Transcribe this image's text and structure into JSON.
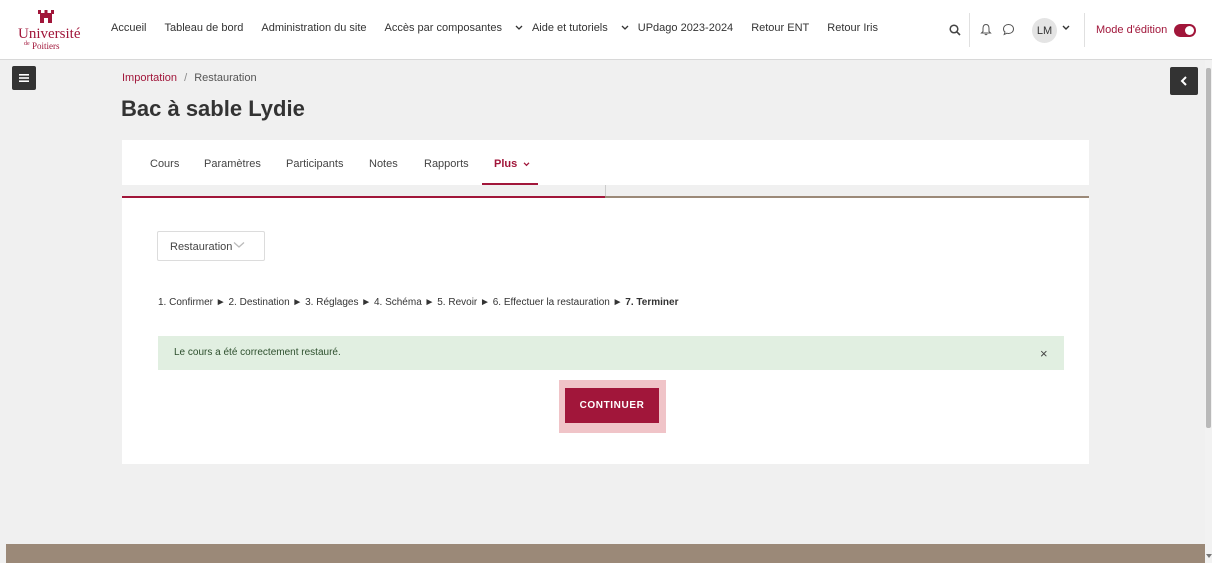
{
  "brand": {
    "univ": "Université",
    "de": "de",
    "poitiers": "Poitiers"
  },
  "nav": {
    "items": [
      {
        "label": "Accueil",
        "dropdown": false
      },
      {
        "label": "Tableau de bord",
        "dropdown": false
      },
      {
        "label": "Administration du site",
        "dropdown": false
      },
      {
        "label": "Accès par composantes",
        "dropdown": true
      },
      {
        "label": "Aide et tutoriels",
        "dropdown": true
      },
      {
        "label": "UPdago 2023-2024",
        "dropdown": false
      },
      {
        "label": "Retour ENT",
        "dropdown": false
      },
      {
        "label": "Retour Iris",
        "dropdown": false
      }
    ]
  },
  "user": {
    "initials": "LM",
    "edit_mode_label": "Mode d'édition",
    "edit_mode_on": true
  },
  "breadcrumb": {
    "link": "Importation",
    "separator": "/",
    "current": "Restauration"
  },
  "course": {
    "title": "Bac à sable Lydie"
  },
  "tabs": [
    {
      "label": "Cours",
      "active": false
    },
    {
      "label": "Paramètres",
      "active": false
    },
    {
      "label": "Participants",
      "active": false
    },
    {
      "label": "Notes",
      "active": false
    },
    {
      "label": "Rapports",
      "active": false
    },
    {
      "label": "Plus",
      "active": true
    }
  ],
  "select": {
    "value": "Restauration"
  },
  "steps": {
    "s1": "1. Confirmer",
    "s2": "2. Destination",
    "s3": "3. Réglages",
    "s4": "4. Schéma",
    "s5": "5. Revoir",
    "s6": "6. Effectuer la restauration",
    "s7": "7. Terminer",
    "arrow": "►"
  },
  "alert": {
    "message": "Le cours a été correctement restauré.",
    "close": "×"
  },
  "button": {
    "continue": "CONTINUER"
  },
  "colors": {
    "brand": "#a1163a",
    "footer": "#9b8978",
    "alert_bg": "#e1efe1",
    "progress_done": "#a1163a",
    "progress_rest": "#9b8978"
  }
}
